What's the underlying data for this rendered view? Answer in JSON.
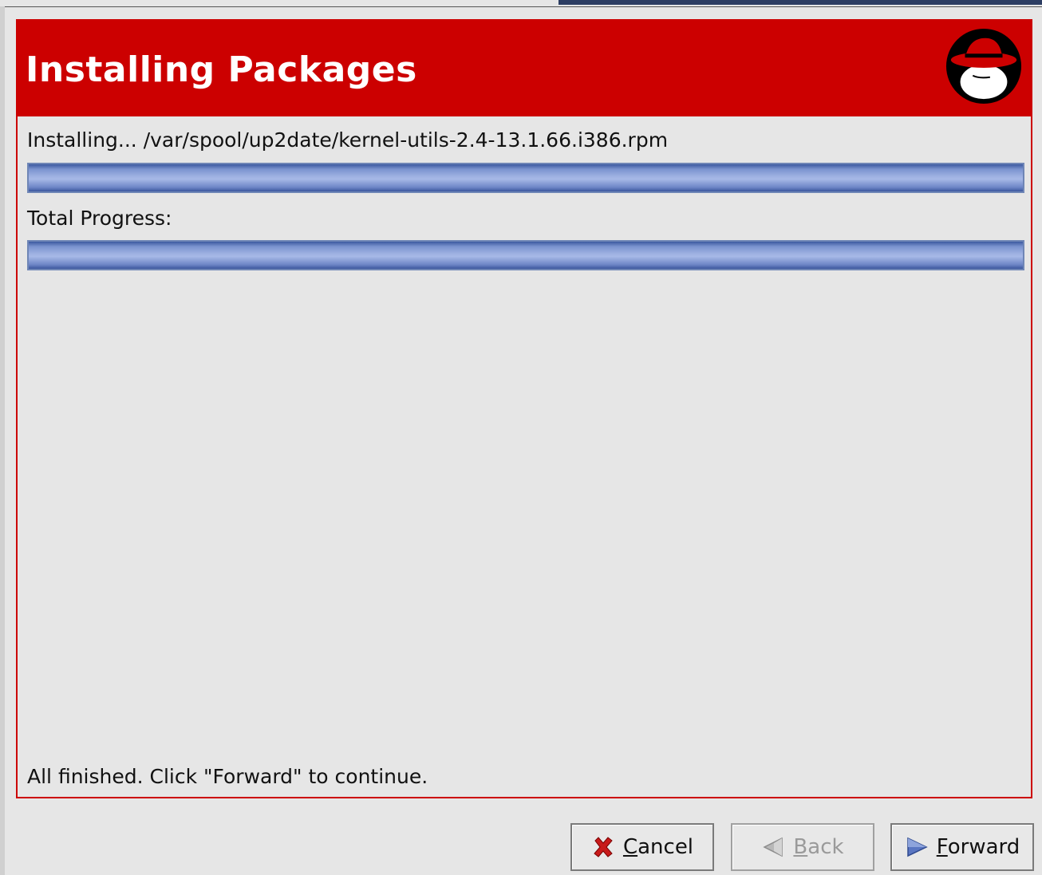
{
  "window": {
    "title": "Installing Packages"
  },
  "status": {
    "current_package_text": "Installing...  /var/spool/up2date/kernel-utils-2.4-13.1.66.i386.rpm",
    "current_package_progress": 1.0,
    "total_progress_label": "Total Progress:",
    "total_progress": 1.0,
    "finished_message": "All finished.  Click \"Forward\" to continue."
  },
  "buttons": {
    "cancel": {
      "mnemonic": "C",
      "rest": "ancel",
      "enabled": true
    },
    "back": {
      "mnemonic": "B",
      "rest": "ack",
      "enabled": false
    },
    "forward": {
      "mnemonic": "F",
      "rest": "orward",
      "enabled": true
    }
  },
  "colors": {
    "banner": "#cc0000",
    "progress_fill": "#7b93cf"
  },
  "icons": {
    "logo": "redhat-shadowman-icon",
    "cancel": "red-x-icon",
    "back": "back-arrow-icon",
    "forward": "forward-arrow-icon"
  }
}
